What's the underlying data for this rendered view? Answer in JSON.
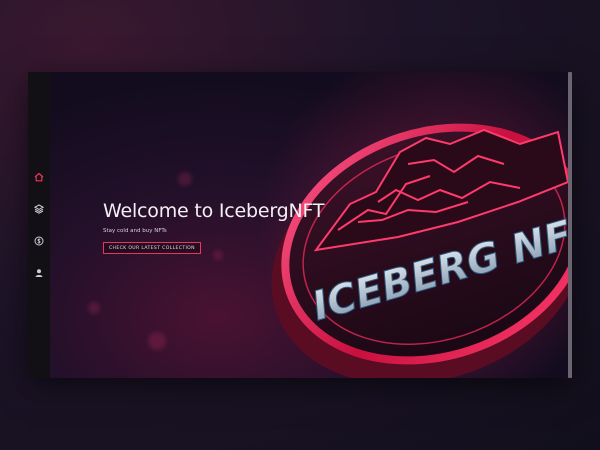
{
  "nav": {
    "items": [
      {
        "name": "home",
        "icon": "home-icon",
        "active": true
      },
      {
        "name": "collection",
        "icon": "layers-icon",
        "active": false
      },
      {
        "name": "buy",
        "icon": "dollar-icon",
        "active": false
      },
      {
        "name": "profile",
        "icon": "user-icon",
        "active": false
      }
    ],
    "active_color": "#e8355c",
    "inactive_color": "#cfcad6"
  },
  "hero": {
    "title": "Welcome to IcebergNFT",
    "subtitle": "Stay cold and buy NFTs",
    "cta_label": "CHECK OUR LATEST COLLECTION",
    "logo_text": "ICEBERG NFT"
  },
  "colors": {
    "accent": "#e8355c",
    "background": "#120c1e"
  }
}
